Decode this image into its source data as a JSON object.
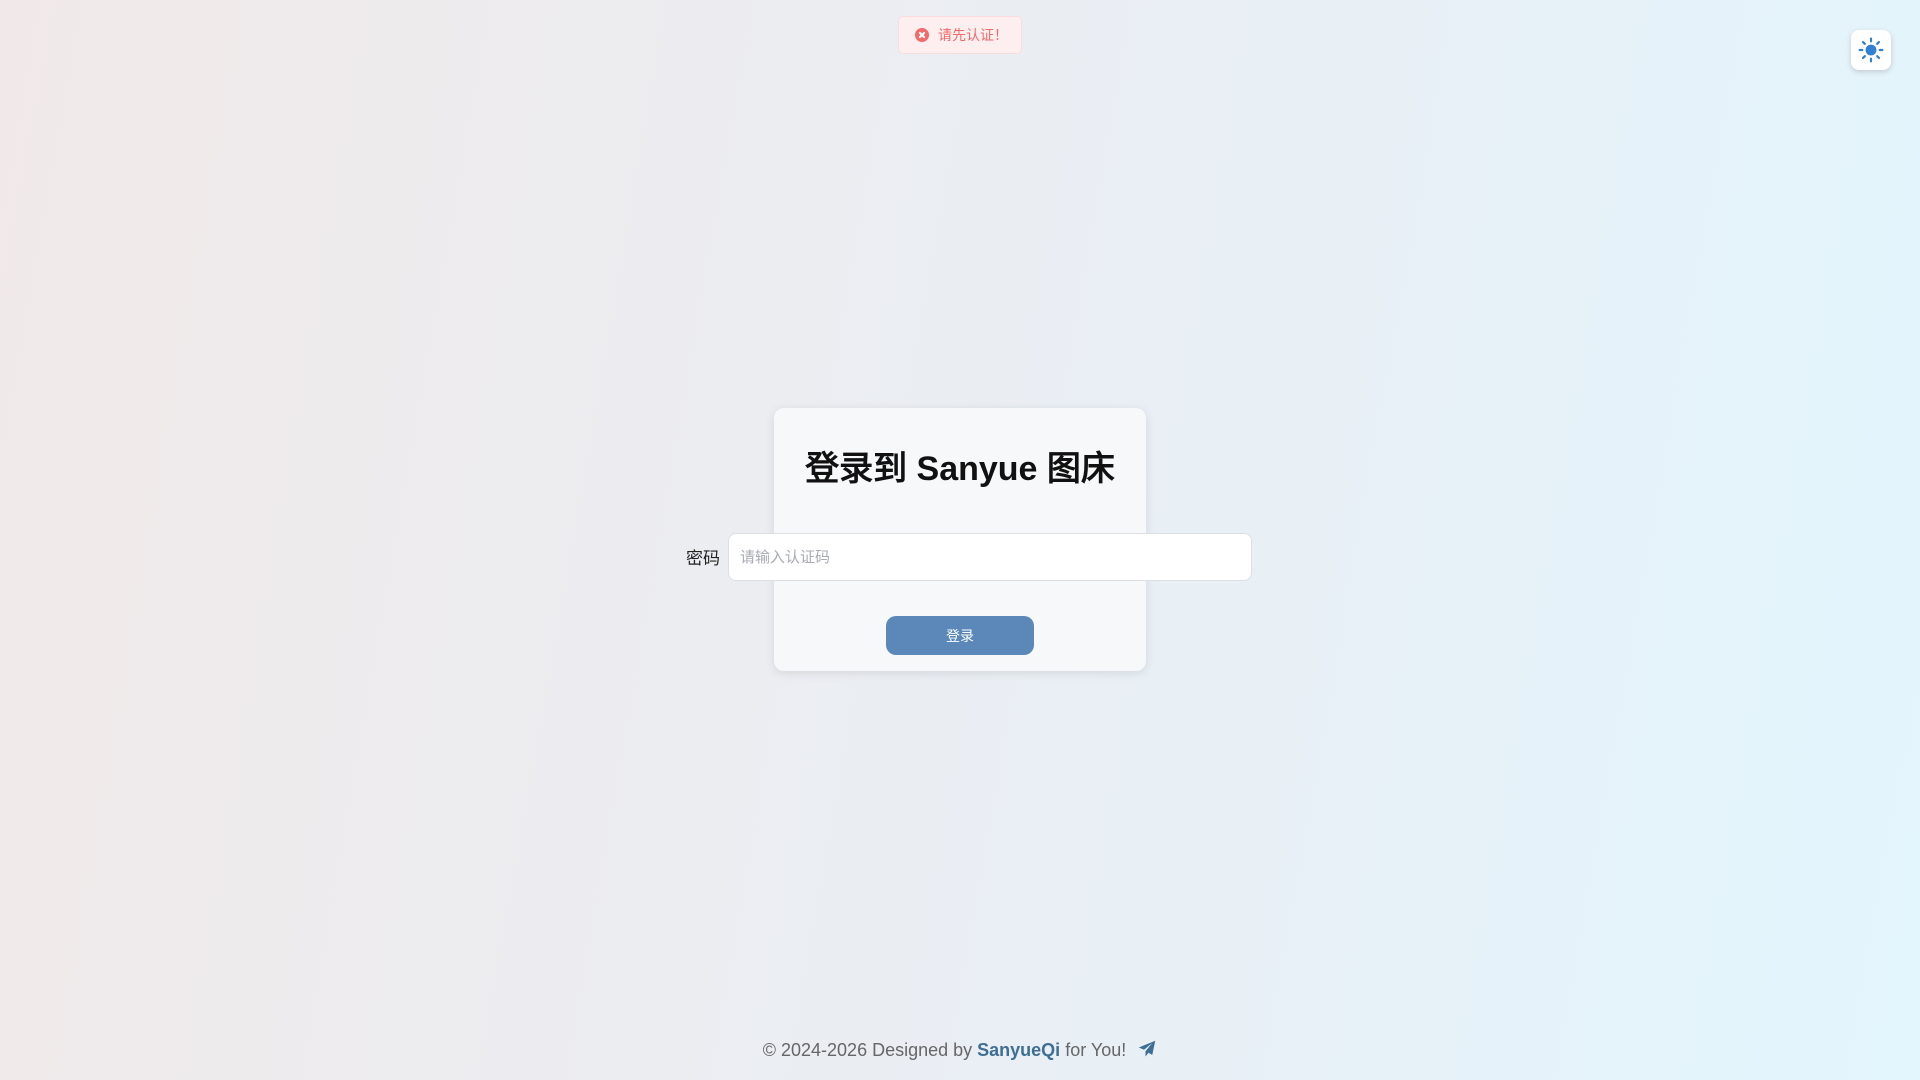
{
  "toast": {
    "message": "请先认证！",
    "icon": "error-circle-icon",
    "color": "#f16b6b"
  },
  "theme_toggle": {
    "icon": "sun-icon",
    "color": "#2f7fd3"
  },
  "login": {
    "title": "登录到 Sanyue 图床",
    "password_label": "密码",
    "password_placeholder": "请输入认证码",
    "password_value": "",
    "submit_label": "登录",
    "button_color": "#5b88b9"
  },
  "footer": {
    "prefix": "© 2024-2026 Designed by ",
    "author": "SanyueQi",
    "suffix": " for You!",
    "icon": "paper-plane-icon",
    "accent_color": "#3f6e94"
  }
}
